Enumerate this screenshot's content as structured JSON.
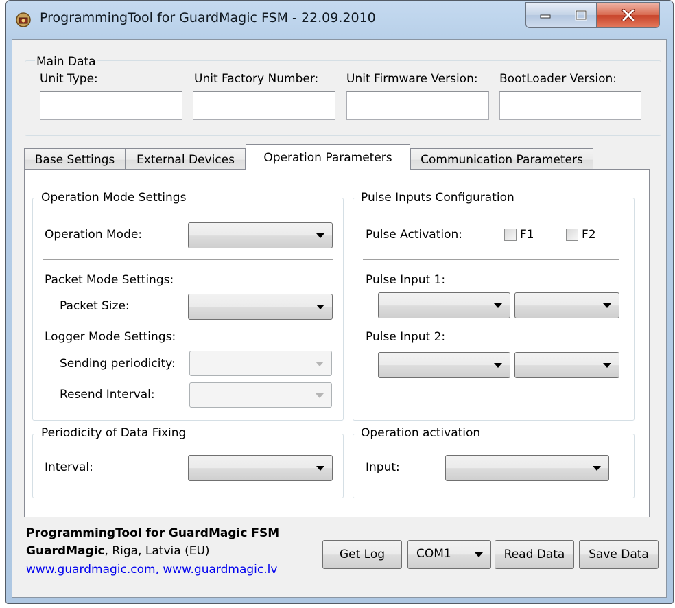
{
  "window": {
    "title": "ProgrammingTool for GuardMagic FSM - 22.09.2010"
  },
  "main_data": {
    "group_title": "Main Data",
    "fields": [
      {
        "label": "Unit Type:",
        "value": ""
      },
      {
        "label": "Unit Factory Number:",
        "value": ""
      },
      {
        "label": "Unit Firmware Version:",
        "value": ""
      },
      {
        "label": "BootLoader Version:",
        "value": ""
      }
    ]
  },
  "tabs": [
    {
      "label": "Base Settings",
      "active": false
    },
    {
      "label": "External Devices",
      "active": false
    },
    {
      "label": "Operation Parameters",
      "active": true
    },
    {
      "label": "Communication Parameters",
      "active": false
    }
  ],
  "operation_mode_settings": {
    "group_title": "Operation Mode Settings",
    "operation_mode_label": "Operation Mode:",
    "operation_mode_value": "",
    "packet_mode_label": "Packet Mode Settings:",
    "packet_size_label": "Packet Size:",
    "packet_size_value": "",
    "logger_mode_label": "Logger Mode Settings:",
    "sending_periodicity_label": "Sending periodicity:",
    "sending_periodicity_value": "",
    "resend_interval_label": "Resend Interval:",
    "resend_interval_value": ""
  },
  "pulse_inputs": {
    "group_title": "Pulse Inputs Configuration",
    "pulse_activation_label": "Pulse Activation:",
    "f1_label": "F1",
    "f1_checked": false,
    "f2_label": "F2",
    "f2_checked": false,
    "pulse_input_1_label": "Pulse Input 1:",
    "pulse_input_2_label": "Pulse Input 2:"
  },
  "data_fixing": {
    "group_title": "Periodicity of Data Fixing",
    "interval_label": "Interval:",
    "interval_value": ""
  },
  "operation_activation": {
    "group_title": "Operation activation",
    "input_label": "Input:",
    "input_value": ""
  },
  "footer": {
    "app_name": "ProgrammingTool for GuardMagic FSM",
    "company": "GuardMagic",
    "location": ", Riga, Latvia (EU)",
    "websites": "www.guardmagic.com, www.guardmagic.lv",
    "get_log_label": "Get Log",
    "com_port_value": "COM1",
    "read_data_label": "Read Data",
    "save_data_label": "Save Data"
  },
  "colors": {
    "title_bar": "#b7cfe8",
    "client_bg": "#f0f0f0",
    "close_button": "#c7432a",
    "link": "#0000ee"
  }
}
